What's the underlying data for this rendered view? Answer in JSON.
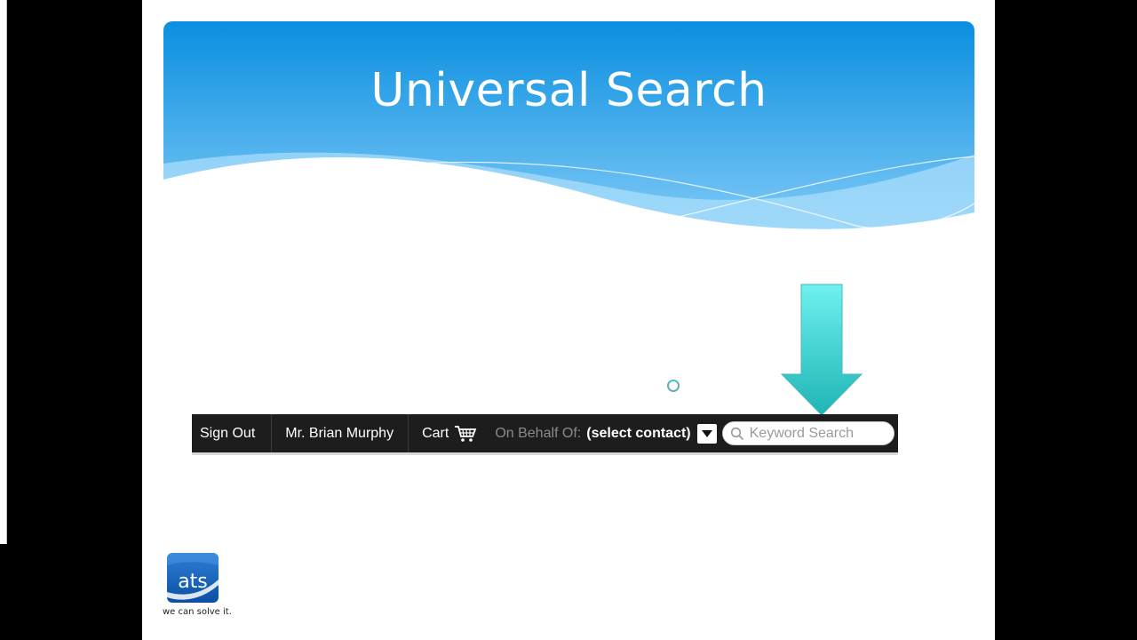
{
  "slide": {
    "title": "Universal Search"
  },
  "toolbar": {
    "sign_out": "Sign Out",
    "user_name": "Mr. Brian Murphy",
    "cart_label": "Cart",
    "cart_icon": "cart-icon",
    "on_behalf_label": "On Behalf Of:",
    "contact_value": "(select contact)",
    "search_placeholder": "Keyword Search",
    "search_icon": "search-icon"
  },
  "logo": {
    "text": "ats",
    "tagline": "we can solve it."
  },
  "colors": {
    "banner_top": "#0a8fe0",
    "banner_bottom": "#7cc8f7",
    "arrow": "#3fd6d6",
    "toolbar_bg": "#1d1d1d"
  }
}
